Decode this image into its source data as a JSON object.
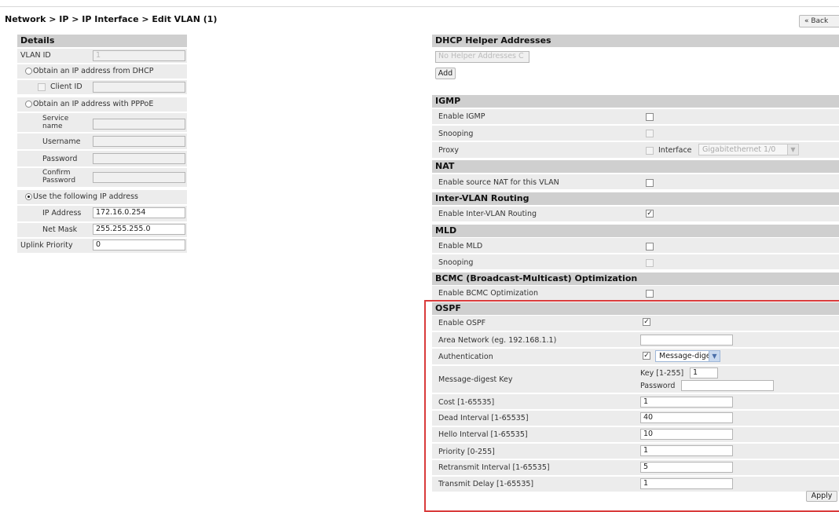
{
  "breadcrumb": "Network > IP > IP Interface > Edit VLAN (1)",
  "back_label": "« Back",
  "details": {
    "title": "Details",
    "vlan_id_label": "VLAN ID",
    "vlan_id_value": "1",
    "dhcp_radio_label": "Obtain an IP address from DHCP",
    "client_id_label": "Client ID",
    "pppoe_radio_label": "Obtain an IP address with PPPoE",
    "service_name_label": "Service name",
    "username_label": "Username",
    "password_label": "Password",
    "confirm_password_label": "Confirm Password",
    "static_radio_label": "Use the following IP address",
    "ip_address_label": "IP Address",
    "ip_address_value": "172.16.0.254",
    "net_mask_label": "Net Mask",
    "net_mask_value": "255.255.255.0",
    "uplink_priority_label": "Uplink Priority",
    "uplink_priority_value": "0"
  },
  "dhcp_helper": {
    "title": "DHCP Helper Addresses",
    "placeholder": "No Helper Addresses C",
    "add_label": "Add"
  },
  "igmp": {
    "title": "IGMP",
    "enable_label": "Enable IGMP",
    "snooping_label": "Snooping",
    "proxy_label": "Proxy",
    "interface_label": "Interface",
    "interface_value": "Gigabitethernet 1/0"
  },
  "nat": {
    "title": "NAT",
    "enable_label": "Enable source NAT for this VLAN"
  },
  "inter_vlan": {
    "title": "Inter-VLAN Routing",
    "enable_label": "Enable Inter-VLAN Routing"
  },
  "mld": {
    "title": "MLD",
    "enable_label": "Enable MLD",
    "snooping_label": "Snooping"
  },
  "bcmc": {
    "title": "BCMC (Broadcast-Multicast) Optimization",
    "enable_label": "Enable BCMC Optimization"
  },
  "ospf": {
    "title": "OSPF",
    "enable_label": "Enable OSPF",
    "area_label": "Area Network (eg. 192.168.1.1)",
    "area_value": "",
    "auth_label": "Authentication",
    "auth_value": "Message-digest",
    "md_key_label": "Message-digest Key",
    "key_label": "Key [1-255]",
    "key_value": "1",
    "password_label": "Password",
    "cost_label": "Cost [1-65535]",
    "cost_value": "1",
    "dead_label": "Dead Interval [1-65535]",
    "dead_value": "40",
    "hello_label": "Hello Interval [1-65535]",
    "hello_value": "10",
    "priority_label": "Priority [0-255]",
    "priority_value": "1",
    "retransmit_label": "Retransmit Interval [1-65535]",
    "retransmit_value": "5",
    "transmit_label": "Transmit Delay [1-65535]",
    "transmit_value": "1"
  },
  "apply_label": "Apply",
  "colors": {
    "section_header": "#cfcfcf",
    "row_bg": "#ececec",
    "highlight_border": "#d93b3b"
  }
}
